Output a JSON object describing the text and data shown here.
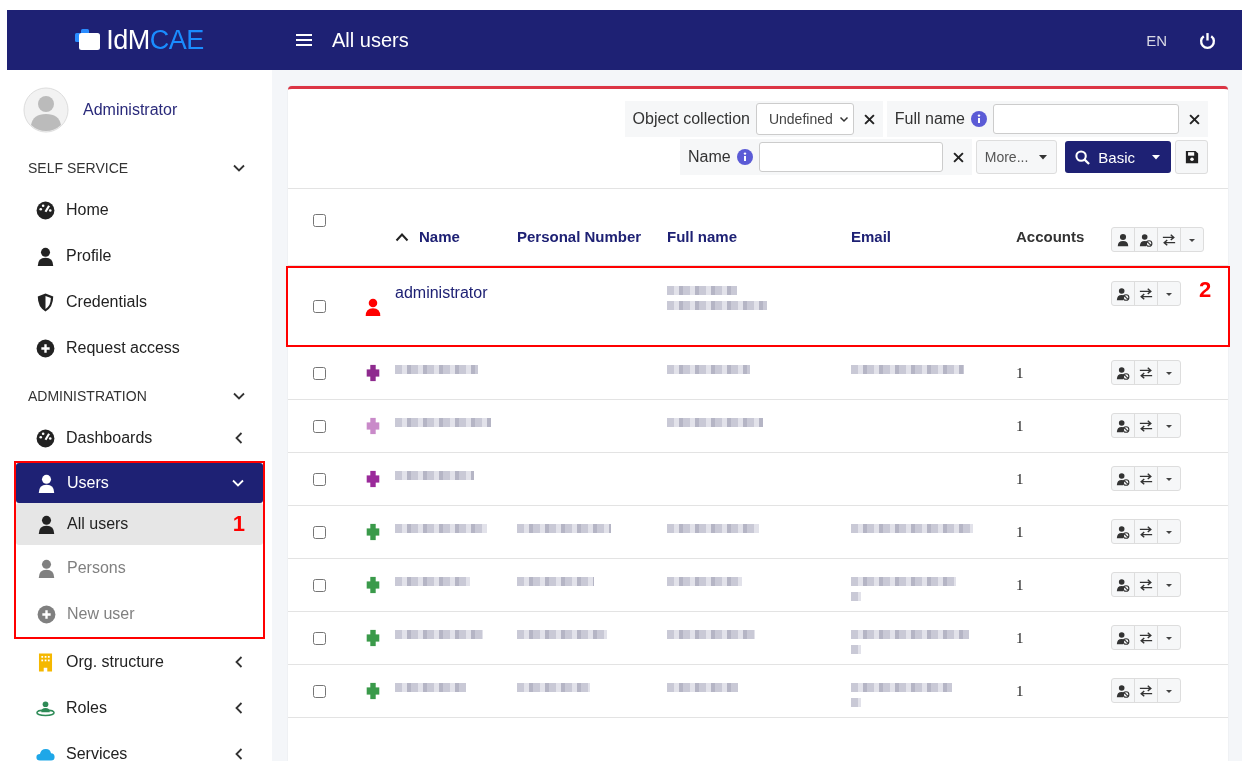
{
  "header": {
    "logo": {
      "main": "IdM",
      "accent": "CAE"
    },
    "title": "All users",
    "language": "EN"
  },
  "sidebar": {
    "user": {
      "name": "Administrator"
    },
    "sections": [
      {
        "title": "SELF SERVICE",
        "expanded": true,
        "items": [
          {
            "label": "Home",
            "kind": "gauge",
            "selected": false
          },
          {
            "label": "Profile",
            "kind": "user",
            "selected": false
          },
          {
            "label": "Credentials",
            "kind": "shield",
            "selected": false
          },
          {
            "label": "Request access",
            "kind": "plus",
            "selected": false
          }
        ]
      },
      {
        "title": "ADMINISTRATION",
        "expanded": true,
        "items": [
          {
            "label": "Dashboards",
            "kind": "gauge",
            "selected": false,
            "expanded": false
          },
          {
            "label": "Users",
            "kind": "user",
            "selected": true,
            "expanded": true,
            "annotation": "1",
            "children": [
              {
                "label": "All users",
                "kind": "user",
                "selected": true,
                "muted": false
              },
              {
                "label": "Persons",
                "kind": "user",
                "selected": false,
                "muted": true
              },
              {
                "label": "New user",
                "kind": "plus",
                "selected": false,
                "muted": true
              }
            ]
          },
          {
            "label": "Org. structure",
            "kind": "building",
            "selected": false,
            "expanded": false
          },
          {
            "label": "Roles",
            "kind": "roles",
            "selected": false,
            "expanded": false
          },
          {
            "label": "Services",
            "kind": "cloud",
            "selected": false,
            "expanded": false
          }
        ]
      }
    ]
  },
  "filters": {
    "object_collection": {
      "label": "Object collection",
      "value": "Undefined"
    },
    "full_name": {
      "label": "Full name"
    },
    "name": {
      "label": "Name"
    },
    "more": "More...",
    "search": "Basic"
  },
  "table": {
    "all_checked": false,
    "columns": [
      {
        "label": "Name",
        "sorted": true
      },
      {
        "label": "Personal Number",
        "sorted": false
      },
      {
        "label": "Full name",
        "sorted": false
      },
      {
        "label": "Email",
        "sorted": false
      },
      {
        "label": "Accounts",
        "sorted": false
      }
    ],
    "header_actions": [
      {
        "kind": "user"
      },
      {
        "kind": "disable"
      },
      {
        "kind": "switch"
      },
      {
        "kind": "menu"
      }
    ],
    "rows": [
      {
        "kind": "person",
        "color": "#ff0000",
        "checked": false,
        "annotation": "2",
        "cells": [
          {
            "kind": "link",
            "text": "administrator"
          },
          {
            "kind": "blank"
          },
          {
            "kind": "blurtall"
          },
          {
            "kind": "blank"
          },
          {
            "kind": "blank"
          }
        ],
        "actions": [
          {
            "kind": "disable"
          },
          {
            "kind": "switch"
          },
          {
            "kind": "menu"
          }
        ]
      },
      {
        "kind": "avatar",
        "color": "#8e2a8e",
        "checked": false,
        "cells": [
          {
            "kind": "blur"
          },
          {
            "kind": "blank"
          },
          {
            "kind": "blur"
          },
          {
            "kind": "blur"
          },
          {
            "kind": "text",
            "text": "1"
          }
        ],
        "actions": [
          {
            "kind": "disable"
          },
          {
            "kind": "switch"
          },
          {
            "kind": "menu"
          }
        ]
      },
      {
        "kind": "avatar",
        "color": "#c98ac9",
        "checked": false,
        "cells": [
          {
            "kind": "blur"
          },
          {
            "kind": "blank"
          },
          {
            "kind": "blur"
          },
          {
            "kind": "blank"
          },
          {
            "kind": "text",
            "text": "1"
          }
        ],
        "actions": [
          {
            "kind": "disable"
          },
          {
            "kind": "switch"
          },
          {
            "kind": "menu"
          }
        ]
      },
      {
        "kind": "avatar",
        "color": "#9a2a9a",
        "checked": false,
        "cells": [
          {
            "kind": "blur"
          },
          {
            "kind": "blank"
          },
          {
            "kind": "blank"
          },
          {
            "kind": "blank"
          },
          {
            "kind": "text",
            "text": "1"
          }
        ],
        "actions": [
          {
            "kind": "disable"
          },
          {
            "kind": "switch"
          },
          {
            "kind": "menu"
          }
        ]
      },
      {
        "kind": "avatar",
        "color": "#3a9a4a",
        "checked": false,
        "cells": [
          {
            "kind": "blur"
          },
          {
            "kind": "blur"
          },
          {
            "kind": "blur"
          },
          {
            "kind": "blur"
          },
          {
            "kind": "text",
            "text": "1"
          }
        ],
        "actions": [
          {
            "kind": "disable"
          },
          {
            "kind": "switch"
          },
          {
            "kind": "menu"
          }
        ]
      },
      {
        "kind": "avatar",
        "color": "#3a9a4a",
        "checked": false,
        "cells": [
          {
            "kind": "blur"
          },
          {
            "kind": "blur"
          },
          {
            "kind": "blur"
          },
          {
            "kind": "blurtall"
          },
          {
            "kind": "text",
            "text": "1"
          }
        ],
        "actions": [
          {
            "kind": "disable"
          },
          {
            "kind": "switch"
          },
          {
            "kind": "menu"
          }
        ]
      },
      {
        "kind": "avatar",
        "color": "#3a9a4a",
        "checked": false,
        "cells": [
          {
            "kind": "blur"
          },
          {
            "kind": "blur"
          },
          {
            "kind": "blur"
          },
          {
            "kind": "blurtall"
          },
          {
            "kind": "text",
            "text": "1"
          }
        ],
        "actions": [
          {
            "kind": "disable"
          },
          {
            "kind": "switch"
          },
          {
            "kind": "menu"
          }
        ]
      },
      {
        "kind": "avatar",
        "color": "#3a9a4a",
        "checked": false,
        "cells": [
          {
            "kind": "blur"
          },
          {
            "kind": "blur"
          },
          {
            "kind": "blur"
          },
          {
            "kind": "blurtall"
          },
          {
            "kind": "text",
            "text": "1"
          }
        ],
        "actions": [
          {
            "kind": "disable"
          },
          {
            "kind": "switch"
          },
          {
            "kind": "menu"
          }
        ]
      }
    ]
  }
}
